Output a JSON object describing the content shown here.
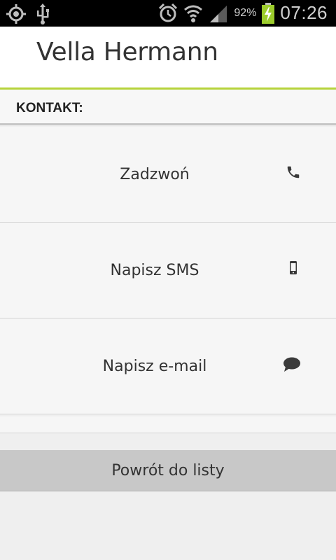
{
  "status_bar": {
    "battery_percent": "92%",
    "time": "07:26",
    "icons": [
      "gps-icon",
      "usb-icon",
      "alarm-icon",
      "wifi-icon",
      "signal-icon",
      "battery-charging-icon"
    ]
  },
  "header": {
    "title": "Vella Hermann"
  },
  "contact": {
    "section_label": "KONTAKT:",
    "actions": [
      {
        "label": "Zadzwoń",
        "icon": "phone-icon"
      },
      {
        "label": "Napisz SMS",
        "icon": "mobile-phone-icon"
      },
      {
        "label": "Napisz e-mail",
        "icon": "chat-bubble-icon"
      }
    ]
  },
  "footer": {
    "back_label": "Powrót do listy"
  },
  "colors": {
    "accent": "#b6d33a",
    "background": "#efefef",
    "button": "#c8c8c8"
  }
}
